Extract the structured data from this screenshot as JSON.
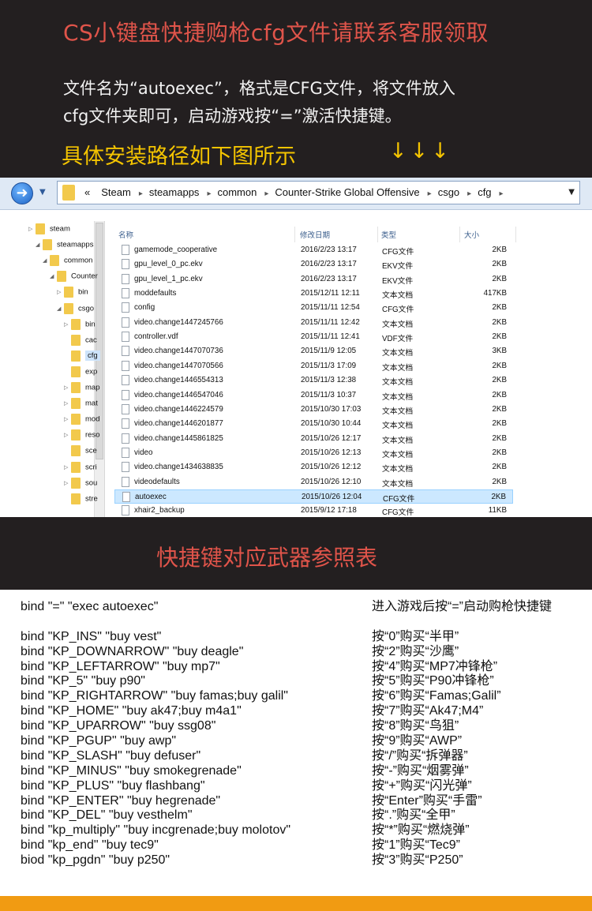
{
  "banner": {
    "headline": "CS小键盘快捷购枪cfg文件请联系客服领取",
    "desc_line1": "文件名为“autoexec”，格式是CFG文件，将文件放入",
    "desc_line2": "cfg文件夹即可，启动游戏按“=”激活快捷键。",
    "subhead": "具体安装路径如下图所示",
    "arrows": "↓↓↓"
  },
  "explorer": {
    "back_icon": "back-arrow-icon",
    "crumb_prefix": "«",
    "crumbs": [
      "Steam",
      "steamapps",
      "common",
      "Counter-Strike Global Offensive",
      "csgo",
      "cfg"
    ],
    "tree": [
      {
        "label": "steam",
        "indent": 0,
        "arrow": "▷"
      },
      {
        "label": "steamapps",
        "indent": 1,
        "arrow": "◢"
      },
      {
        "label": "common",
        "indent": 2,
        "arrow": "◢"
      },
      {
        "label": "Counter",
        "indent": 3,
        "arrow": "◢"
      },
      {
        "label": "bin",
        "indent": 4,
        "arrow": "▷"
      },
      {
        "label": "csgo",
        "indent": 4,
        "arrow": "◢"
      },
      {
        "label": "bin",
        "indent": 5,
        "arrow": "▷"
      },
      {
        "label": "cac",
        "indent": 5,
        "arrow": ""
      },
      {
        "label": "cfg",
        "indent": 5,
        "arrow": "",
        "selected": true
      },
      {
        "label": "exp",
        "indent": 5,
        "arrow": ""
      },
      {
        "label": "map",
        "indent": 5,
        "arrow": "▷"
      },
      {
        "label": "mat",
        "indent": 5,
        "arrow": "▷"
      },
      {
        "label": "mod",
        "indent": 5,
        "arrow": "▷"
      },
      {
        "label": "reso",
        "indent": 5,
        "arrow": "▷"
      },
      {
        "label": "sce",
        "indent": 5,
        "arrow": ""
      },
      {
        "label": "scri",
        "indent": 5,
        "arrow": "▷"
      },
      {
        "label": "sou",
        "indent": 5,
        "arrow": "▷"
      },
      {
        "label": "stre",
        "indent": 5,
        "arrow": ""
      }
    ],
    "columns": {
      "name": "名称",
      "date": "修改日期",
      "type": "类型",
      "size": "大小"
    },
    "files": [
      {
        "name": "gamemode_cooperative",
        "date": "2016/2/23 13:17",
        "type": "CFG文件",
        "size": "2KB"
      },
      {
        "name": "gpu_level_0_pc.ekv",
        "date": "2016/2/23 13:17",
        "type": "EKV文件",
        "size": "2KB"
      },
      {
        "name": "gpu_level_1_pc.ekv",
        "date": "2016/2/23 13:17",
        "type": "EKV文件",
        "size": "2KB"
      },
      {
        "name": "moddefaults",
        "date": "2015/12/11 12:11",
        "type": " 文本文档",
        "size": "417KB"
      },
      {
        "name": "config",
        "date": "2015/11/11 12:54",
        "type": "CFG文件",
        "size": "2KB"
      },
      {
        "name": "video.change1447245766",
        "date": "2015/11/11 12:42",
        "type": " 文本文档",
        "size": "2KB"
      },
      {
        "name": "controller.vdf",
        "date": "2015/11/11 12:41",
        "type": " VDF文件",
        "size": "2KB"
      },
      {
        "name": "video.change1447070736",
        "date": "2015/11/9  12:05",
        "type": "文本文档",
        "size": "3KB"
      },
      {
        "name": "video.change1447070566",
        "date": "2015/11/3  17:09",
        "type": "文本文档",
        "size": "2KB"
      },
      {
        "name": "video.change1446554313",
        "date": "2015/11/3  12:38",
        "type": "文本文档",
        "size": "2KB"
      },
      {
        "name": "video.change1446547046",
        "date": "2015/11/3  10:37",
        "type": "文本文档",
        "size": "2KB"
      },
      {
        "name": "video.change1446224579",
        "date": "2015/10/30 17:03",
        "type": "文本文档",
        "size": "2KB"
      },
      {
        "name": "video.change1446201877",
        "date": "2015/10/30 10:44",
        "type": "文本文档",
        "size": "2KB"
      },
      {
        "name": "video.change1445861825",
        "date": "2015/10/26 12:17",
        "type": "文本文档",
        "size": "2KB"
      },
      {
        "name": "video",
        "date": "2015/10/26 12:13",
        "type": "文本文档",
        "size": "2KB"
      },
      {
        "name": "video.change1434638835",
        "date": "2015/10/26 12:12",
        "type": "文本文档",
        "size": "2KB"
      },
      {
        "name": "videodefaults",
        "date": "2015/10/26 12:10",
        "type": "文本文档",
        "size": "2KB"
      },
      {
        "name": "autoexec",
        "date": "2015/10/26 12:04",
        "type": "CFG文件",
        "size": "2KB",
        "selected": true
      },
      {
        "name": "xhair2_backup",
        "date": "2015/9/12 17:18",
        "type": "CFG文件",
        "size": "11KB"
      }
    ]
  },
  "section2_title": "快捷键对应武器参照表",
  "binds": [
    {
      "cmd": "bind \"=\" \"exec autoexec\"",
      "note": "进入游戏后按“=”启动购枪快捷键"
    },
    {
      "cmd": "",
      "note": ""
    },
    {
      "cmd": "bind \"KP_INS\" \"buy vest\"",
      "note": "按“0”购买“半甲”"
    },
    {
      "cmd": "bind \"KP_DOWNARROW\" \"buy deagle\"",
      "note": "按“2”购买“沙鹰”"
    },
    {
      "cmd": "bind \"KP_LEFTARROW\" \"buy mp7\"",
      "note": "按“4”购买“MP7冲锋枪”"
    },
    {
      "cmd": "bind \"KP_5\" \"buy p90\"",
      "note": "按“5”购买“P90冲锋枪”"
    },
    {
      "cmd": "bind \"KP_RIGHTARROW\" \"buy famas;buy galil\"",
      "note": "按“6”购买“Famas;Galil”"
    },
    {
      "cmd": "bind \"KP_HOME\" \"buy ak47;buy m4a1\"",
      "note": "按“7”购买“Ak47;M4”"
    },
    {
      "cmd": "bind \"KP_UPARROW\" \"buy ssg08\"",
      "note": "按“8”购买“鸟狙”"
    },
    {
      "cmd": "bind \"KP_PGUP\" \"buy awp\"",
      "note": "按“9”购买“AWP”"
    },
    {
      "cmd": "bind \"KP_SLASH\" \"buy defuser\"",
      "note": "按“/”购买“拆弹器”"
    },
    {
      "cmd": "bind \"KP_MINUS\" \"buy smokegrenade\"",
      "note": "按“-”购买“烟雾弹”"
    },
    {
      "cmd": "bind \"KP_PLUS\" \"buy flashbang\"",
      "note": "按“+”购买“闪光弹”"
    },
    {
      "cmd": "bind \"KP_ENTER\" \"buy hegrenade\"",
      "note": "按“Enter”购买“手雷”"
    },
    {
      "cmd": "bind \"KP_DEL\" \"buy vesthelm\"",
      "note": "按“.”购买“全甲”"
    },
    {
      "cmd": "bind \"kp_multiply\" \"buy incgrenade;buy molotov\"",
      "note": "按“*”购买“燃烧弹”"
    },
    {
      "cmd": "bind \"kp_end\" \"buy tec9\"",
      "note": "按“1”购买“Tec9”"
    },
    {
      "cmd": "biod \"kp_pgdn\" \"buy p250\"",
      "note": "按“3”购买“P250”"
    }
  ],
  "colors": {
    "dark_band": "#231f20",
    "title_red": "#e0544a",
    "subhead_yellow": "#f4c400",
    "footer_orange": "#f19b12",
    "selection": "#cce8ff"
  }
}
